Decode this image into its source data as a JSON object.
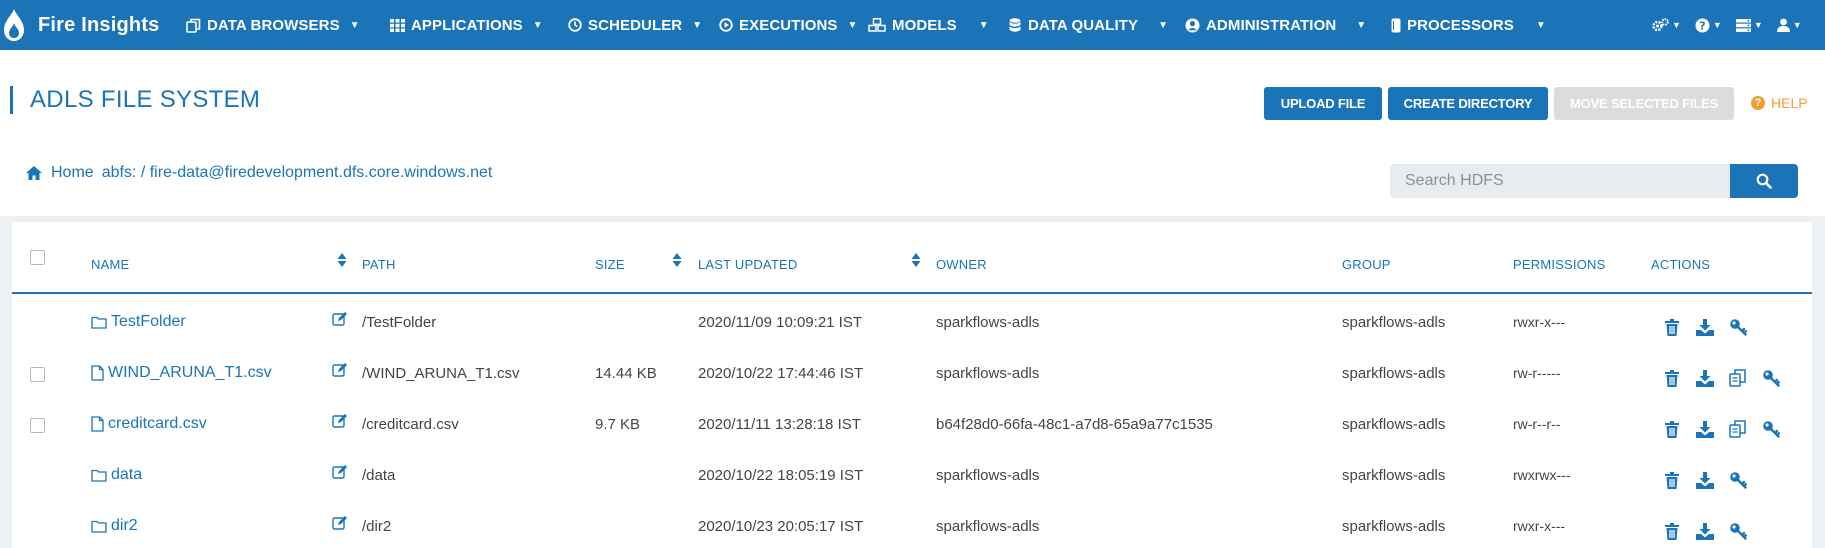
{
  "app": {
    "brand": "Fire Insights",
    "nav": [
      {
        "label": "DATA BROWSERS",
        "icon": "copy-icon"
      },
      {
        "label": "APPLICATIONS",
        "icon": "grid-icon"
      },
      {
        "label": "SCHEDULER",
        "icon": "clock-icon"
      },
      {
        "label": "EXECUTIONS",
        "icon": "play-circle-icon"
      },
      {
        "label": "MODELS",
        "icon": "cubes-icon"
      },
      {
        "label": "DATA QUALITY",
        "icon": "database-icon"
      },
      {
        "label": "ADMINISTRATION",
        "icon": "user-circle-icon"
      },
      {
        "label": "PROCESSORS",
        "icon": "cylinder-icon"
      }
    ]
  },
  "page": {
    "title": "ADLS FILE SYSTEM",
    "buttons": {
      "upload": "UPLOAD FILE",
      "create_dir": "CREATE DIRECTORY",
      "move": "MOVE SELECTED FILES",
      "help": "HELP"
    },
    "breadcrumb": {
      "home": "Home",
      "path": "abfs: / fire-data@firedevelopment.dfs.core.windows.net"
    },
    "search": {
      "placeholder": "Search HDFS"
    }
  },
  "table": {
    "columns": [
      "NAME",
      "PATH",
      "SIZE",
      "LAST UPDATED",
      "OWNER",
      "GROUP",
      "PERMISSIONS",
      "ACTIONS"
    ],
    "rows": [
      {
        "type": "folder",
        "name": "TestFolder",
        "path": "/TestFolder",
        "size": "",
        "updated": "2020/11/09 10:09:21 IST",
        "owner": "sparkflows-adls",
        "group": "sparkflows-adls",
        "perms": "rwxr-x---",
        "checkbox": false,
        "copy": false
      },
      {
        "type": "file",
        "name": "WIND_ARUNA_T1.csv",
        "path": "/WIND_ARUNA_T1.csv",
        "size": "14.44 KB",
        "updated": "2020/10/22 17:44:46 IST",
        "owner": "sparkflows-adls",
        "group": "sparkflows-adls",
        "perms": "rw-r-----",
        "checkbox": true,
        "copy": true
      },
      {
        "type": "file",
        "name": "creditcard.csv",
        "path": "/creditcard.csv",
        "size": "9.7 KB",
        "updated": "2020/11/11 13:28:18 IST",
        "owner": "b64f28d0-66fa-48c1-a7d8-65a9a77c1535",
        "group": "sparkflows-adls",
        "perms": "rw-r--r--",
        "checkbox": true,
        "copy": true
      },
      {
        "type": "folder",
        "name": "data",
        "path": "/data",
        "size": "",
        "updated": "2020/10/22 18:05:19 IST",
        "owner": "sparkflows-adls",
        "group": "sparkflows-adls",
        "perms": "rwxrwx---",
        "checkbox": false,
        "copy": false
      },
      {
        "type": "folder",
        "name": "dir2",
        "path": "/dir2",
        "size": "",
        "updated": "2020/10/23 20:05:17 IST",
        "owner": "sparkflows-adls",
        "group": "sparkflows-adls",
        "perms": "rwxr-x---",
        "checkbox": false,
        "copy": false
      }
    ]
  },
  "colors": {
    "primary": "#1b74b8",
    "help": "#f0a030",
    "disabled": "#dcdcdc"
  }
}
